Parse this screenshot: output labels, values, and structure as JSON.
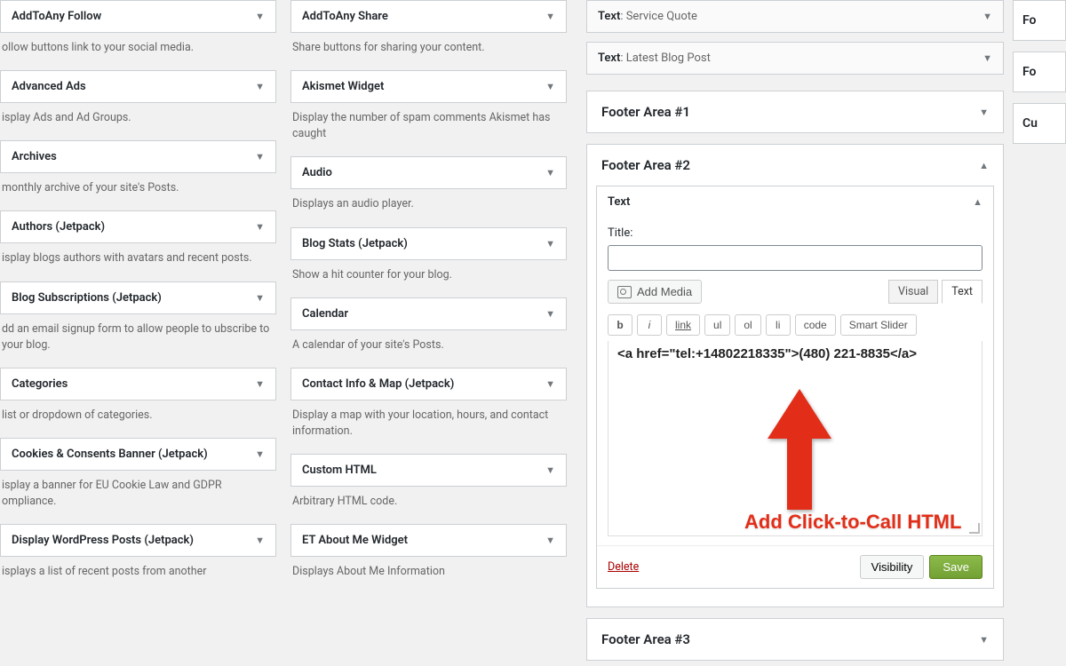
{
  "widgets_left": [
    {
      "title": "AddToAny Follow",
      "desc": "ollow buttons link to your social media."
    },
    {
      "title": "Advanced Ads",
      "desc": "isplay Ads and Ad Groups."
    },
    {
      "title": "Archives",
      "desc": "monthly archive of your site's Posts."
    },
    {
      "title": "Authors (Jetpack)",
      "desc": "isplay blogs authors with avatars and recent posts."
    },
    {
      "title": "Blog Subscriptions (Jetpack)",
      "desc": "dd an email signup form to allow people to ubscribe to your blog."
    },
    {
      "title": "Categories",
      "desc": "list or dropdown of categories."
    },
    {
      "title": "Cookies & Consents Banner (Jetpack)",
      "desc": "isplay a banner for EU Cookie Law and GDPR ompliance."
    },
    {
      "title": "Display WordPress Posts (Jetpack)",
      "desc": "isplays a list of recent posts from another"
    }
  ],
  "widgets_right": [
    {
      "title": "AddToAny Share",
      "desc": "Share buttons for sharing your content."
    },
    {
      "title": "Akismet Widget",
      "desc": "Display the number of spam comments Akismet has caught"
    },
    {
      "title": "Audio",
      "desc": "Displays an audio player."
    },
    {
      "title": "Blog Stats (Jetpack)",
      "desc": "Show a hit counter for your blog."
    },
    {
      "title": "Calendar",
      "desc": "A calendar of your site's Posts."
    },
    {
      "title": "Contact Info & Map (Jetpack)",
      "desc": "Display a map with your location, hours, and contact information."
    },
    {
      "title": "Custom HTML",
      "desc": "Arbitrary HTML code."
    },
    {
      "title": "ET About Me Widget",
      "desc": "Displays About Me Information"
    }
  ],
  "top_inner_widgets": [
    {
      "type": "Text",
      "subtitle": "Service Quote"
    },
    {
      "type": "Text",
      "subtitle": "Latest Blog Post"
    }
  ],
  "footer1": {
    "title": "Footer Area #1"
  },
  "footer2": {
    "title": "Footer Area #2",
    "text_widget_label": "Text",
    "title_label": "Title:",
    "title_value": "",
    "add_media": "Add Media",
    "tabs": {
      "visual": "Visual",
      "text": "Text"
    },
    "toolbar": [
      "b",
      "i",
      "link",
      "ul",
      "ol",
      "li",
      "code",
      "Smart Slider"
    ],
    "editor_content": "<a href=\"tel:+14802218335\">(480) 221-8835</a>",
    "delete": "Delete",
    "visibility": "Visibility",
    "save": "Save"
  },
  "footer3": {
    "title": "Footer Area #3"
  },
  "far_right": [
    "Fo",
    "Fo",
    "Cu"
  ],
  "annotation": "Add Click-to-Call HTML"
}
